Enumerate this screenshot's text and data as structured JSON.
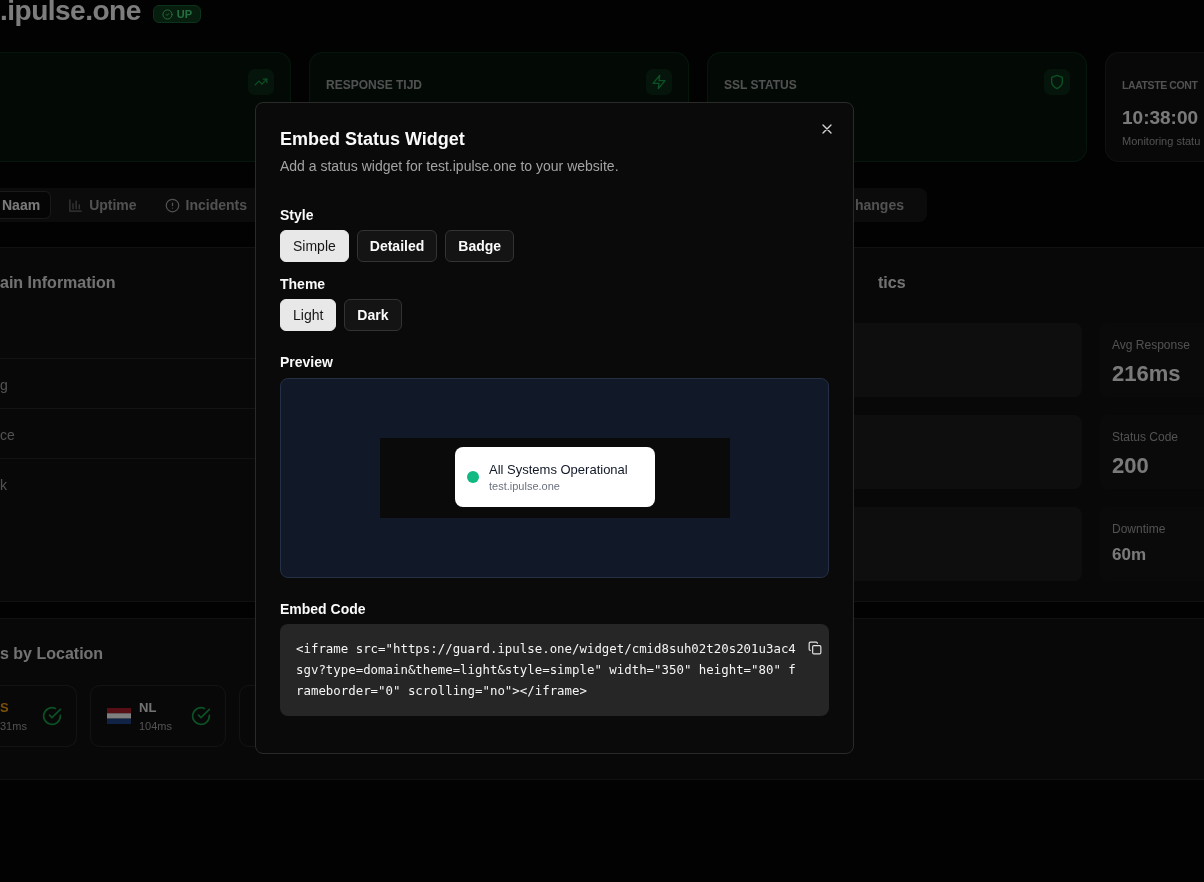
{
  "header": {
    "title": ".ipulse.one",
    "status_badge": "UP"
  },
  "stat_cards": [
    {
      "kind": "trend"
    },
    {
      "kind": "response",
      "label": "RESPONSE TIJD"
    },
    {
      "kind": "ssl",
      "label": "SSL STATUS"
    },
    {
      "kind": "time",
      "label": "LAATSTE CONT",
      "value": "10:38:00",
      "note": "Monitoring statu"
    }
  ],
  "tabs": [
    {
      "kind": "name",
      "label": "Naam",
      "selected": true
    },
    {
      "kind": "uptime",
      "label": "Uptime",
      "selected": false
    },
    {
      "kind": "incidents",
      "label": "Incidents",
      "selected": false
    },
    {
      "kind": "changes",
      "label": "hanges",
      "selected": false
    }
  ],
  "domain_info": {
    "title": "ain Information",
    "rows": [
      "g",
      "ce",
      "k"
    ]
  },
  "statistics": {
    "title": "tics",
    "items": [
      {
        "label": "Avg Response",
        "value": "216ms"
      },
      {
        "label": "Status Code",
        "value": "200"
      },
      {
        "label": "Downtime",
        "value": "60m"
      }
    ]
  },
  "locations": {
    "title": "s by Location",
    "items": [
      {
        "kind": "cut",
        "code": "S",
        "latency": "31ms",
        "ok": true
      },
      {
        "kind": "nl",
        "code": "NL",
        "latency": "104ms",
        "ok": true
      }
    ]
  },
  "modal": {
    "title": "Embed Status Widget",
    "subtitle": "Add a status widget for test.ipulse.one to your website.",
    "style_label": "Style",
    "styles": [
      {
        "label": "Simple",
        "selected": true
      },
      {
        "label": "Detailed",
        "selected": false
      },
      {
        "label": "Badge",
        "selected": false
      }
    ],
    "theme_label": "Theme",
    "themes": [
      {
        "label": "Light",
        "selected": true
      },
      {
        "label": "Dark",
        "selected": false
      }
    ],
    "preview_label": "Preview",
    "widget": {
      "status": "All Systems Operational",
      "domain": "test.ipulse.one"
    },
    "code_label": "Embed Code",
    "code": "<iframe src=\"https://guard.ipulse.one/widget/cmid8suh02t20s201u3ac4sgv?type=domain&theme=light&style=simple\" width=\"350\" height=\"80\" frameborder=\"0\" scrolling=\"no\"></iframe>"
  }
}
